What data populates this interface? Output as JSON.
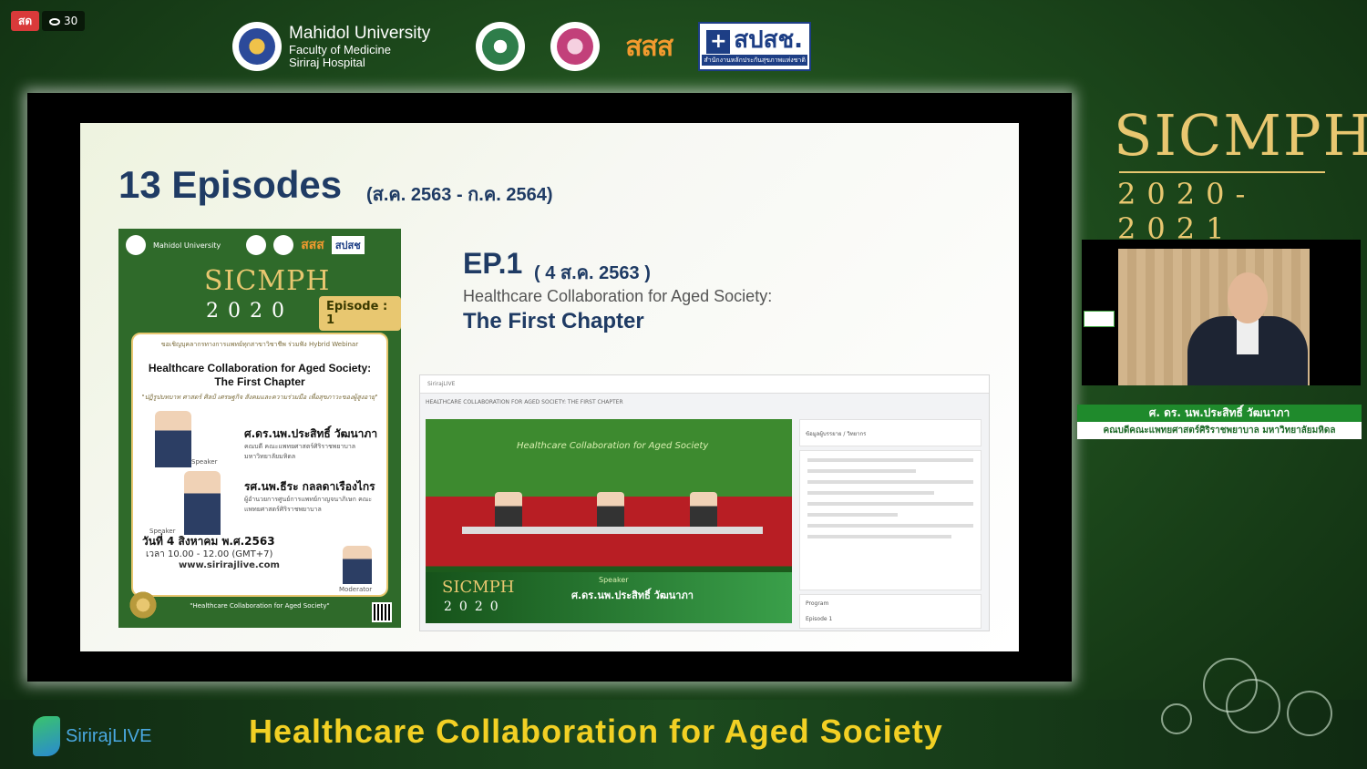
{
  "stream": {
    "live_label": "สด",
    "viewer_count": "30"
  },
  "sponsors": {
    "mahidol": {
      "line1": "Mahidol University",
      "line2": "Faculty of Medicine",
      "line3": "Siriraj Hospital"
    },
    "thaihealth": "สสส",
    "nhso": {
      "top": "สปสช.",
      "sub": "สำนักงานหลักประกันสุขภาพแห่งชาติ"
    }
  },
  "slide": {
    "title": "13 Episodes",
    "date_range": "(ส.ค. 2563 - ก.ค. 2564)",
    "ep": "EP.1",
    "ep_date": "( 4 ส.ค. 2563 )",
    "ep_line1": "Healthcare Collaboration for Aged Society:",
    "ep_line2": "The First Chapter"
  },
  "poster": {
    "header_text": "Mahidol University",
    "nhso": "สปสช",
    "thaihealth": "สสส",
    "logo": "SICMPH",
    "year": "2020",
    "episode": "Episode : 1",
    "invite": "ขอเชิญบุคลากรทางการแพทย์ทุกสาขาวิชาชีพ ร่วมฟัง Hybrid Webinar",
    "title_line1": "Healthcare Collaboration for Aged Society:",
    "title_line2": "The First Chapter",
    "subtitle": "\"ปฏิรูปบทบาท ศาสตร์ ศิลป์ เศรษฐกิจ สังคมและความร่วมมือ เพื่อสุขภาวะของผู้สูงอายุ\"",
    "speaker1": "ศ.ดร.นพ.ประสิทธิ์ วัฒนาภา",
    "speaker1_role": "คณบดี คณะแพทยศาสตร์ศิริราชพยาบาล มหาวิทยาลัยมหิดล",
    "speaker2": "รศ.นพ.ธีระ กลลดาเรืองไกร",
    "speaker2_role": "ผู้อำนวยการศูนย์การแพทย์กาญจนาภิเษก คณะแพทยศาสตร์ศิริราชพยาบาล",
    "speaker_label": "Speaker",
    "moderator_label": "Moderator",
    "date": "วันที่ 4 สิงหาคม พ.ศ.2563",
    "time": "เวลา 10.00 - 12.00 (GMT+7)",
    "url": "www.sirirajlive.com",
    "footer": "\"Healthcare Collaboration for Aged Society\""
  },
  "web": {
    "topbar": "SirirajLIVE",
    "heading": "HEALTHCARE COLLABORATION FOR AGED SOCIETY: THE FIRST CHAPTER",
    "video_banner": "Healthcare Collaboration for Aged Society",
    "video_logo": "SICMPH",
    "video_year": "2020",
    "video_speaker_label": "Speaker",
    "video_speaker_name": "ศ.ดร.นพ.ประสิทธิ์ วัฒนาภา",
    "panel1": "ข้อมูลผู้บรรยาย / วิทยากร",
    "panel3_a": "Program",
    "panel3_b": "Episode 1"
  },
  "brand": {
    "name": "SICMPH",
    "years": "2020-2021"
  },
  "nameplate": {
    "name": "ศ. ดร. นพ.ประสิทธิ์  วัฒนาภา",
    "title": "คณบดีคณะแพทยศาสตร์ศิริราชพยาบาล  มหาวิทยาลัยมหิดล"
  },
  "footer": {
    "logo_text": "SirirajLIVE",
    "caption": "Healthcare Collaboration for Aged Society"
  },
  "colors": {
    "gold": "#e8c770",
    "caption_yellow": "#f2d024",
    "live_red": "#d93a3a",
    "navy": "#1f3b64"
  }
}
